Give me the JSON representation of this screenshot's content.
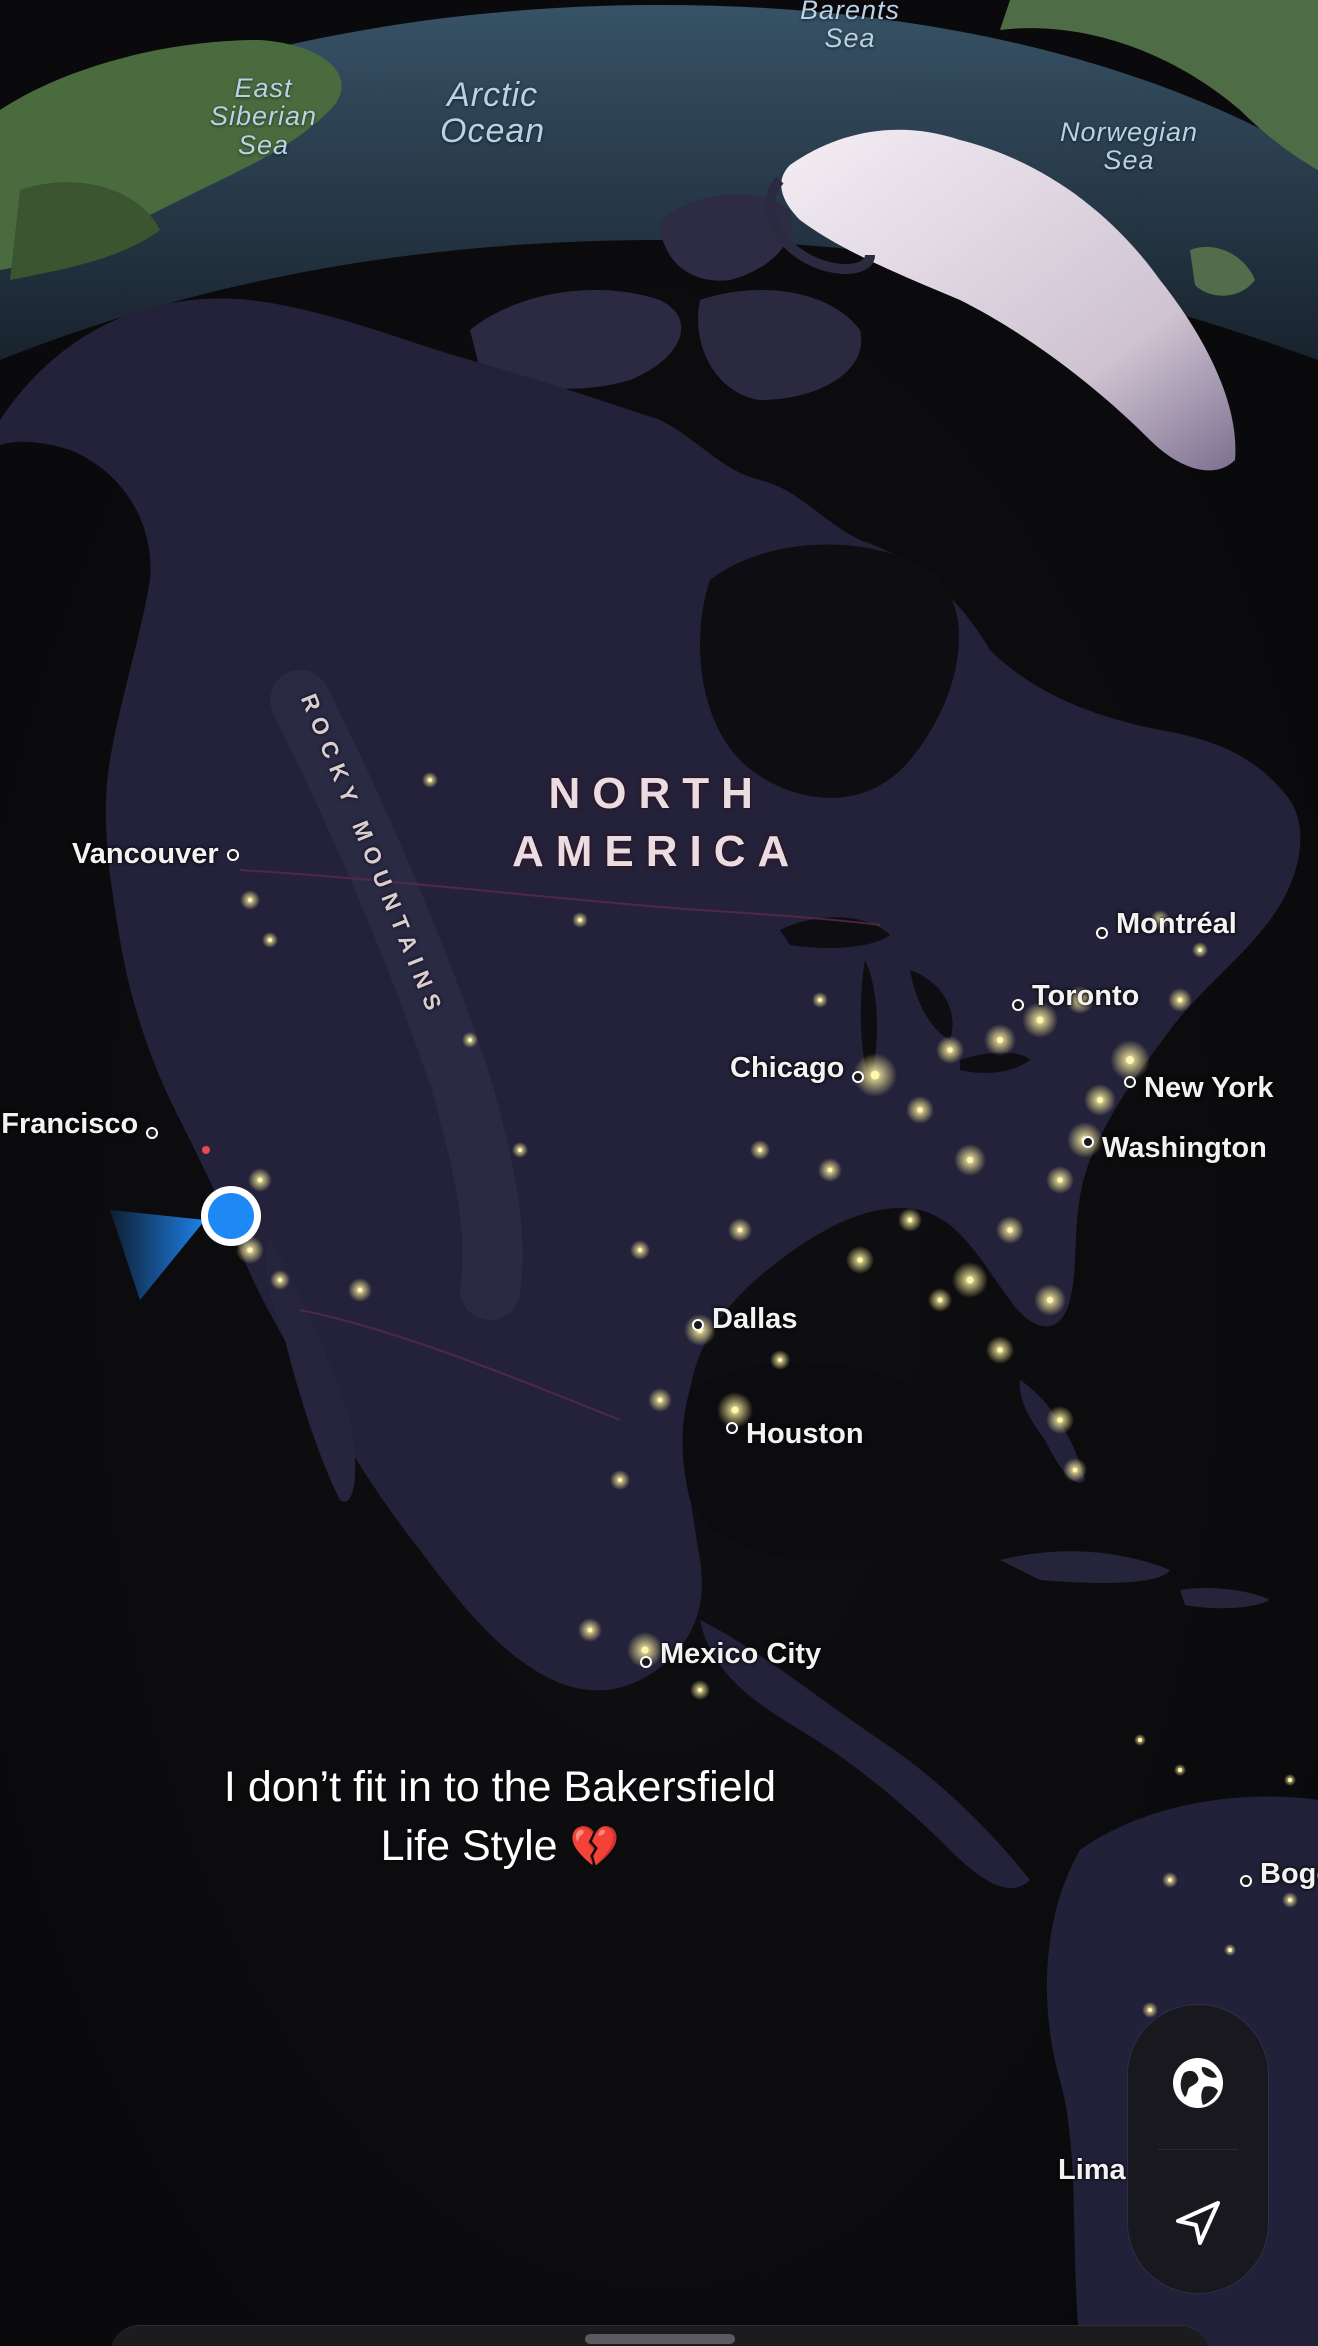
{
  "map": {
    "ocean_labels": [
      {
        "id": "east-siberian-sea",
        "lines": [
          "East",
          "Siberian",
          "Sea"
        ]
      },
      {
        "id": "arctic-ocean",
        "lines": [
          "Arctic",
          "Ocean"
        ]
      },
      {
        "id": "barents-sea",
        "lines": [
          "Barents",
          "Sea"
        ]
      },
      {
        "id": "norwegian-sea",
        "lines": [
          "Norwegian",
          "Sea"
        ]
      }
    ],
    "continent_label": [
      "NORTH",
      "AMERICA"
    ],
    "mountain_label": "ROCKY MOUNTAINS",
    "cities": {
      "vancouver": "Vancouver",
      "san_francisco": "San Francisco",
      "montreal": "Montréal",
      "toronto": "Toronto",
      "chicago": "Chicago",
      "new_york": "New York",
      "washington": "Washington",
      "dallas": "Dallas",
      "houston": "Houston",
      "mexico_city": "Mexico City",
      "bogota": "Bogotá",
      "lima": "Lima"
    },
    "user_location": {
      "color": "#1e88f5",
      "heading_icon": "heading-cone"
    }
  },
  "caption": {
    "line1": "I don’t fit in to the Bakersfield",
    "line2": "Life Style",
    "emoji": "💔"
  },
  "controls": {
    "globe_icon": "globe-icon",
    "location_icon": "location-arrow-icon"
  },
  "colors": {
    "ocean": "#0b0b0d",
    "land_night": "#23223a",
    "city_lights": "#f5e68a",
    "greenland_ice": "#e8dde6",
    "accent_blue": "#1e88f5"
  }
}
